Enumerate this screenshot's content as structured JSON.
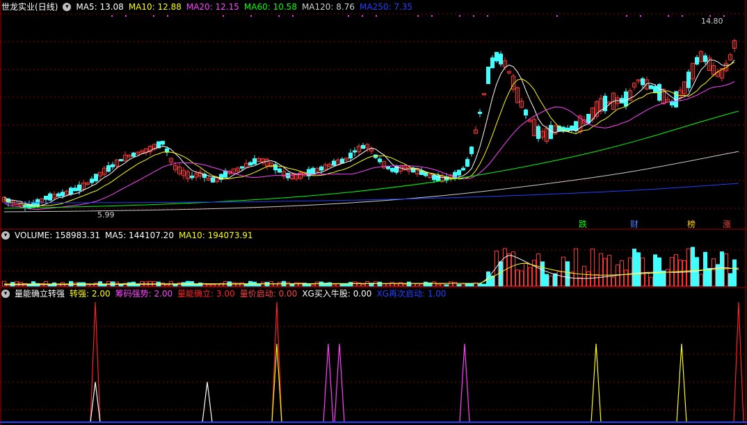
{
  "stock": {
    "name": "世龙实业",
    "period": "(日线)"
  },
  "main_indicators": [
    {
      "label": "MA5: 13.08",
      "color": "#ffffff"
    },
    {
      "label": "MA10: 12.88",
      "color": "#ffff00"
    },
    {
      "label": "MA20: 12.15",
      "color": "#ff40ff"
    },
    {
      "label": "MA60: 10.58",
      "color": "#00ff00"
    },
    {
      "label": "MA120: 8.76",
      "color": "#d0d0d0"
    },
    {
      "label": "MA250: 7.35",
      "color": "#2040ff"
    }
  ],
  "price_labels": {
    "high": "14.80",
    "low": "5.99"
  },
  "signal_badges": [
    {
      "text": "跌",
      "color": "#00ff00"
    },
    {
      "text": "财",
      "color": "#4080ff"
    },
    {
      "text": "榜",
      "color": "#ffcc00"
    },
    {
      "text": "涨",
      "color": "#ff4040"
    }
  ],
  "volume_header": {
    "title": "VOLUME: 158983.31",
    "ma5": "MA5: 144107.20",
    "ma10": "MA10: 194073.91"
  },
  "sub_header": {
    "title": "量能确立转强",
    "items": [
      {
        "label": "转强: 2.00",
        "color": "#ffff00"
      },
      {
        "label": "筹码强势: 2.00",
        "color": "#ff40ff"
      },
      {
        "label": "量能确立: 3.00",
        "color": "#ff2020"
      },
      {
        "label": "量价启动: 0.00",
        "color": "#ff4040"
      },
      {
        "label": "XG买入牛股: 0.00",
        "color": "#ffffff"
      },
      {
        "label": "XG再次启动: 1.00",
        "color": "#2040ff"
      }
    ]
  },
  "colors": {
    "up": "#ff3030",
    "down": "#40ffff",
    "grid": "#8b0000"
  }
}
